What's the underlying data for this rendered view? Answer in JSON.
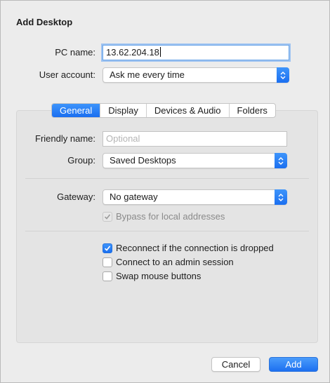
{
  "window": {
    "title": "Add Desktop"
  },
  "form": {
    "pc_name_label": "PC name:",
    "pc_name_value": "13.62.204.18",
    "user_account_label": "User account:",
    "user_account_value": "Ask me every time"
  },
  "tabs": [
    {
      "label": "General",
      "active": true
    },
    {
      "label": "Display",
      "active": false
    },
    {
      "label": "Devices & Audio",
      "active": false
    },
    {
      "label": "Folders",
      "active": false
    }
  ],
  "general": {
    "friendly_name_label": "Friendly name:",
    "friendly_name_placeholder": "Optional",
    "group_label": "Group:",
    "group_value": "Saved Desktops",
    "gateway_label": "Gateway:",
    "gateway_value": "No gateway",
    "bypass_label": "Bypass for local addresses",
    "bypass_checked": true,
    "bypass_enabled": false,
    "reconnect_label": "Reconnect if the connection is dropped",
    "reconnect_checked": true,
    "admin_label": "Connect to an admin session",
    "admin_checked": false,
    "swap_label": "Swap mouse buttons",
    "swap_checked": false
  },
  "buttons": {
    "cancel": "Cancel",
    "add": "Add"
  },
  "colors": {
    "accent": "#1b6ff0",
    "background": "#ececec",
    "panel": "#e4e4e4"
  }
}
